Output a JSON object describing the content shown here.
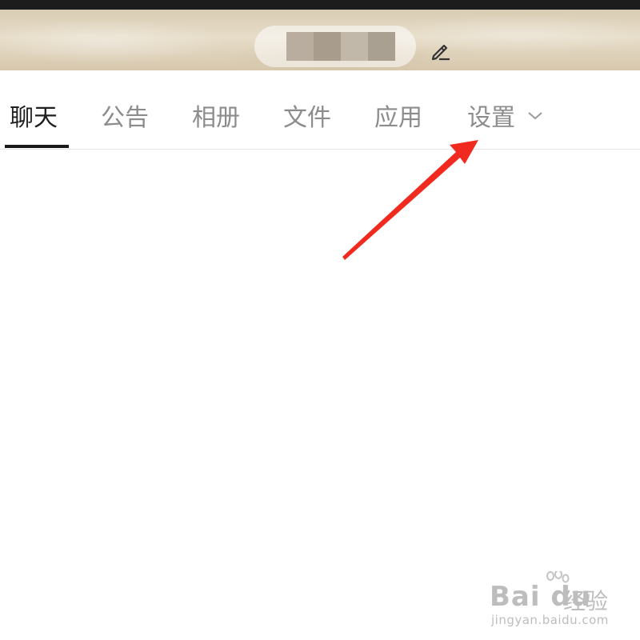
{
  "header": {
    "edit_icon": "pencil-icon"
  },
  "tabs": [
    {
      "label": "聊天",
      "active": true
    },
    {
      "label": "公告",
      "active": false
    },
    {
      "label": "相册",
      "active": false
    },
    {
      "label": "文件",
      "active": false
    },
    {
      "label": "应用",
      "active": false
    },
    {
      "label": "设置",
      "active": false,
      "has_dropdown": true
    }
  ],
  "annotation": {
    "color": "#f02a1f"
  },
  "watermark": {
    "brand": "Bai du",
    "cn": "经验",
    "url": "jingyan.baidu.com"
  }
}
